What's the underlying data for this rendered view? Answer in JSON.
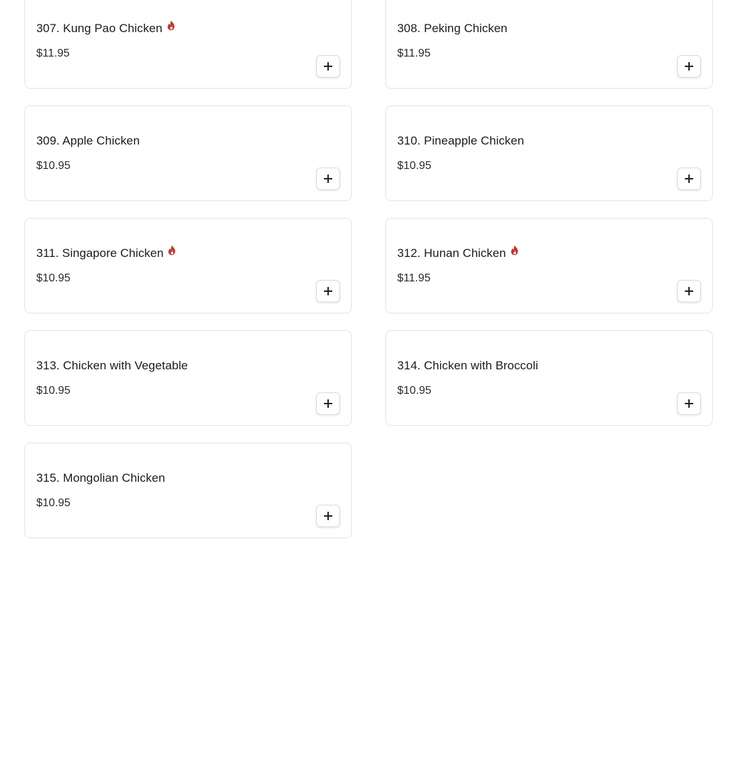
{
  "menu": {
    "accent_color": "#c0362c",
    "items": [
      {
        "name": "307. Kung Pao Chicken",
        "price": "$11.95",
        "spicy": true,
        "icon": "spicy-icon"
      },
      {
        "name": "308. Peking Chicken",
        "price": "$11.95",
        "spicy": false
      },
      {
        "name": "309. Apple Chicken",
        "price": "$10.95",
        "spicy": false
      },
      {
        "name": "310. Pineapple Chicken",
        "price": "$10.95",
        "spicy": false
      },
      {
        "name": "311. Singapore Chicken",
        "price": "$10.95",
        "spicy": true,
        "icon": "spicy-icon"
      },
      {
        "name": "312. Hunan Chicken",
        "price": "$11.95",
        "spicy": true,
        "icon": "spicy-icon"
      },
      {
        "name": "313. Chicken with Vegetable",
        "price": "$10.95",
        "spicy": false
      },
      {
        "name": "314. Chicken with Broccoli",
        "price": "$10.95",
        "spicy": false
      },
      {
        "name": "315. Mongolian Chicken",
        "price": "$10.95",
        "spicy": false
      }
    ],
    "add_button_icon": "plus-icon"
  }
}
